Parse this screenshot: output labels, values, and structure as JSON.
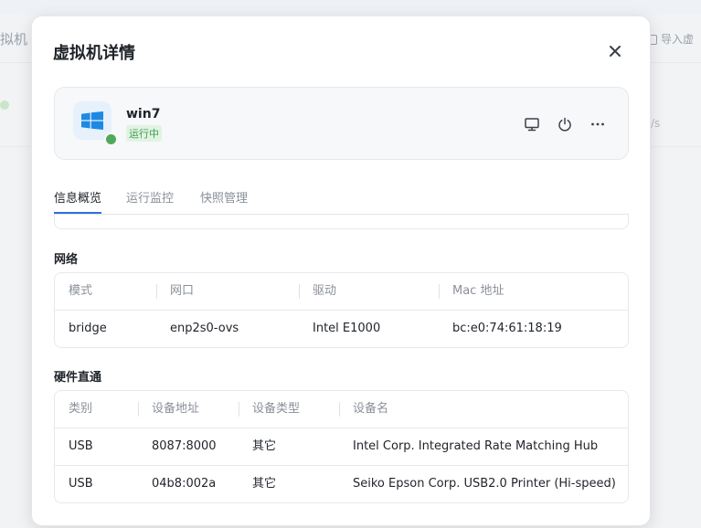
{
  "background": {
    "page_title_fragment": "拟机",
    "import_label": "导入虚",
    "stray_text": "/s"
  },
  "modal": {
    "title": "虚拟机详情",
    "close_icon": "close-icon"
  },
  "vm": {
    "os_icon": "windows-logo-icon",
    "name": "win7",
    "status": "运行中",
    "status_color": "#52a85a",
    "actions": [
      {
        "name": "console-icon"
      },
      {
        "name": "power-icon"
      },
      {
        "name": "more-icon"
      }
    ]
  },
  "tabs": [
    {
      "label": "信息概览",
      "active": true
    },
    {
      "label": "运行监控",
      "active": false
    },
    {
      "label": "快照管理",
      "active": false
    }
  ],
  "accent_color": "#2f6fde",
  "network": {
    "title": "网络",
    "columns": [
      "模式",
      "网口",
      "驱动",
      "Mac 地址"
    ],
    "rows": [
      [
        "bridge",
        "enp2s0-ovs",
        "Intel E1000",
        "bc:e0:74:61:18:19"
      ]
    ]
  },
  "passthrough": {
    "title": "硬件直通",
    "columns": [
      "类别",
      "设备地址",
      "设备类型",
      "设备名"
    ],
    "rows": [
      [
        "USB",
        "8087:8000",
        "其它",
        "Intel Corp. Integrated Rate Matching Hub"
      ],
      [
        "USB",
        "04b8:002a",
        "其它",
        "Seiko Epson Corp. USB2.0 Printer (Hi-speed)"
      ]
    ]
  }
}
